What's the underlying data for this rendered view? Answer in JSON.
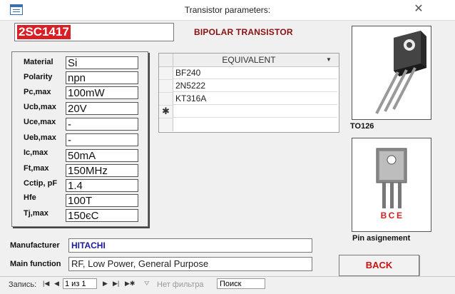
{
  "window": {
    "title": "Transistor parameters:",
    "close_glyph": "✕"
  },
  "part": {
    "number": "2SC1417",
    "type": "BIPOLAR TRANSISTOR"
  },
  "params": [
    {
      "label": "Material",
      "value": "Si"
    },
    {
      "label": "Polarity",
      "value": "npn"
    },
    {
      "label": "Pc,max",
      "value": "100mW"
    },
    {
      "label": "Ucb,max",
      "value": "20V"
    },
    {
      "label": "Uce,max",
      "value": "-"
    },
    {
      "label": "Ueb,max",
      "value": "-"
    },
    {
      "label": "Ic,max",
      "value": "50mA"
    },
    {
      "label": "Ft,max",
      "value": "150MHz"
    },
    {
      "label": "Cctip, pF",
      "value": "1.4"
    },
    {
      "label": "Hfe",
      "value": "100T"
    },
    {
      "label": "Tj,max",
      "value": "150єC"
    }
  ],
  "equivalent": {
    "header": "EQUIVALENT",
    "rows": [
      "BF240",
      "2N5222",
      "KT316A"
    ],
    "new_row_marker": "✱"
  },
  "package": {
    "caption": "TO126",
    "pin_labels": [
      "B",
      "C",
      "E"
    ],
    "pin_caption": "Pin asignement"
  },
  "manufacturer": {
    "label": "Manufacturer",
    "value": "HITACHI"
  },
  "main_function": {
    "label": "Main function",
    "value": "RF, Low Power, General Purpose"
  },
  "back_button": {
    "label": "BACK"
  },
  "navigation": {
    "record_label": "Запись:",
    "counter": "1 из 1",
    "filter_label": "Нет фильтра",
    "search_placeholder": "Поиск"
  },
  "colors": {
    "part_highlight": "#d91f26",
    "type_text": "#8b1111",
    "manufacturer_text": "#1a1a9c",
    "back_text": "#cc1111"
  }
}
